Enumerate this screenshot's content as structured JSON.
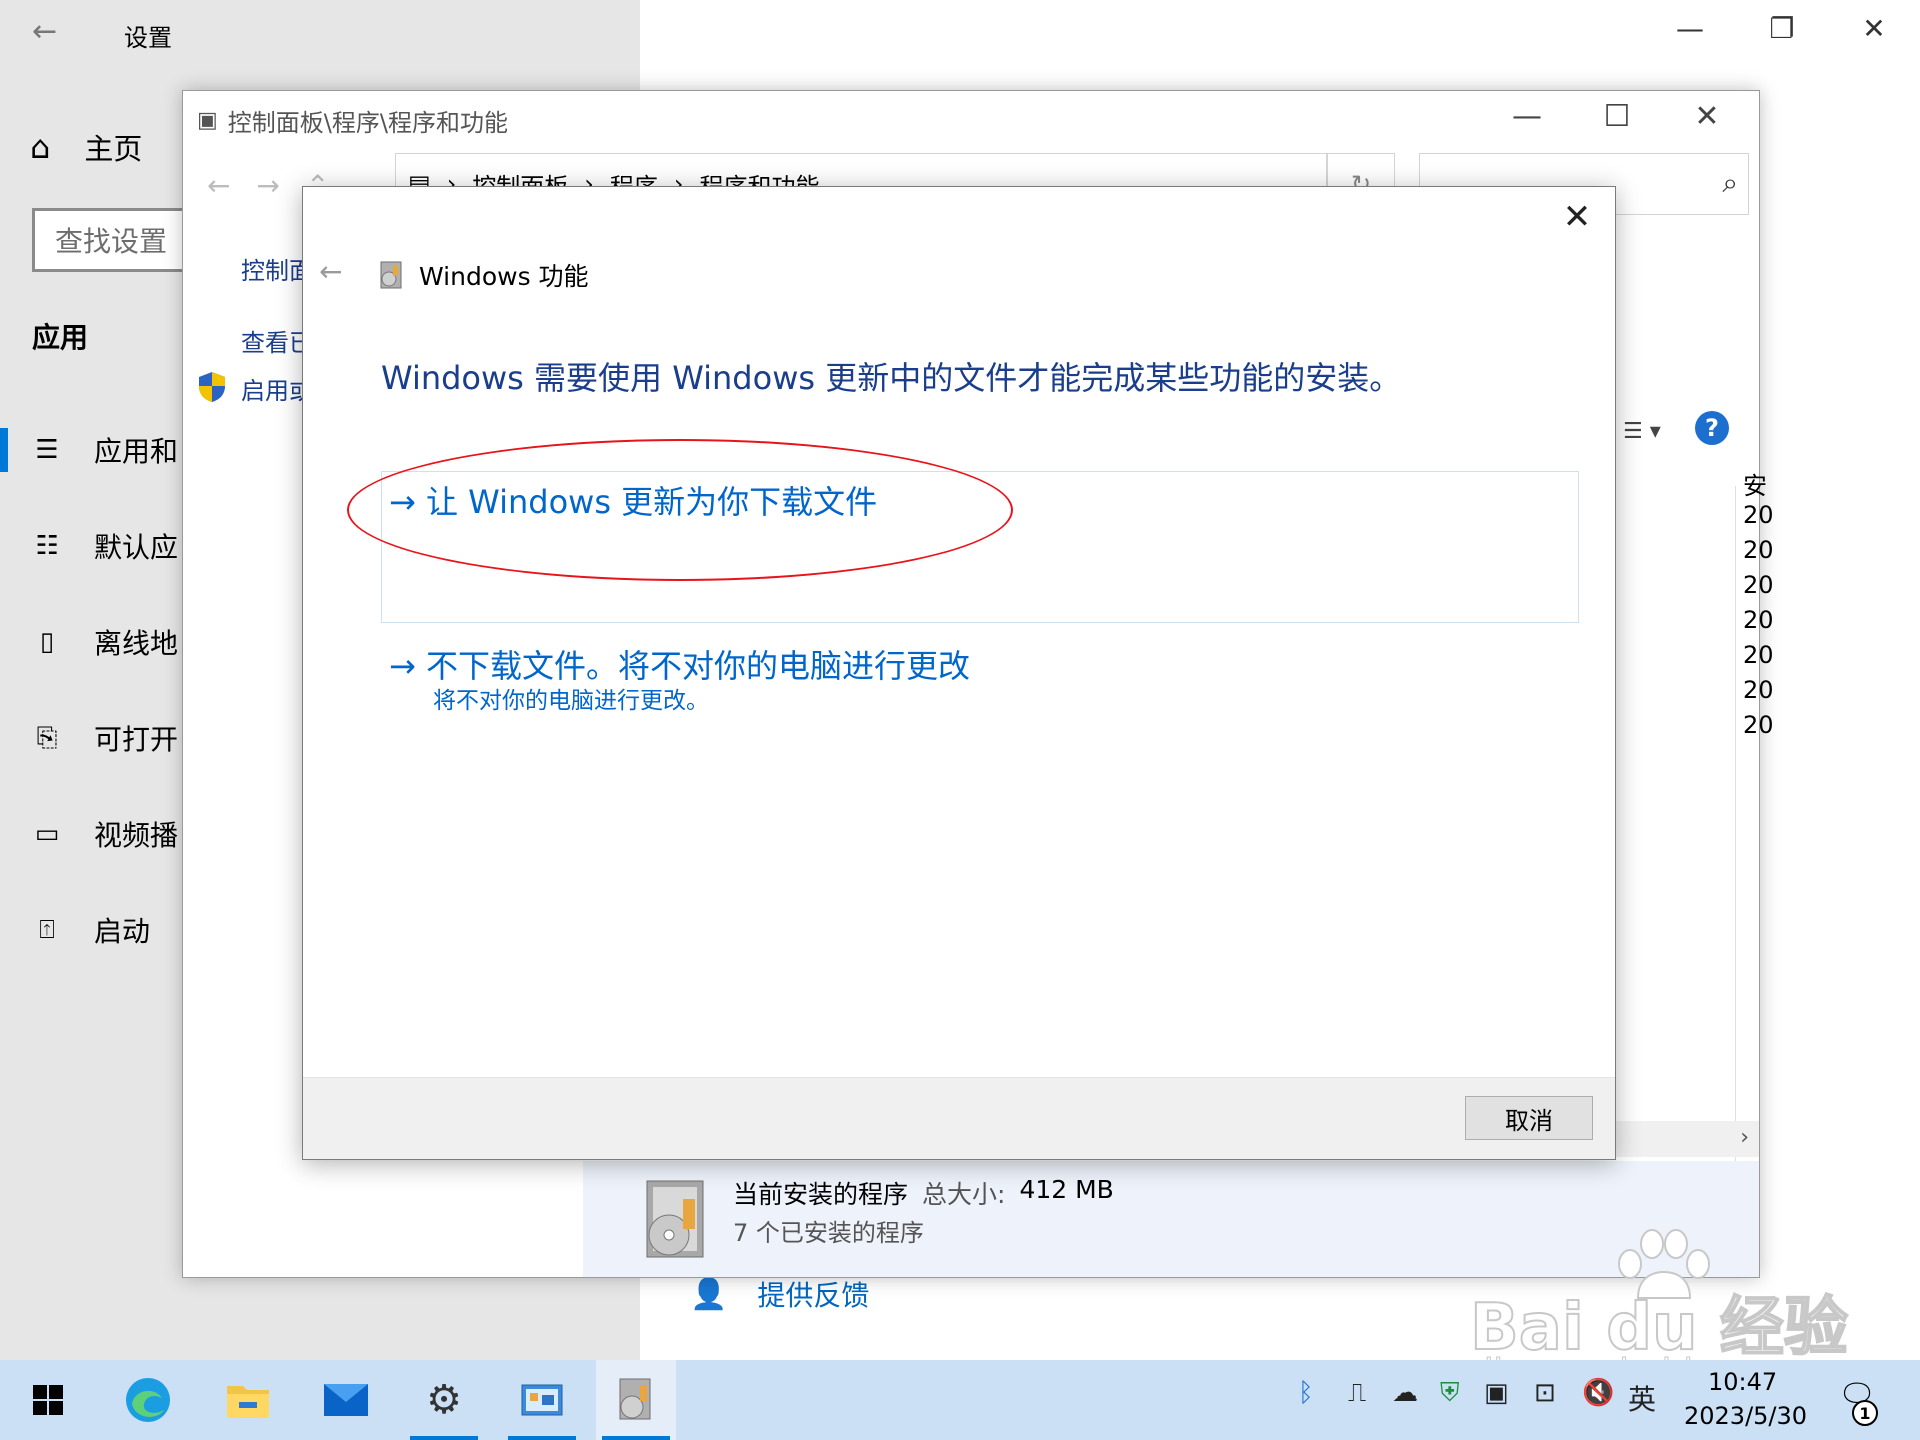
{
  "settings": {
    "title": "设置",
    "back_icon": "←",
    "minimize": "—",
    "restore": "❐",
    "close": "✕",
    "home_label": "主页",
    "search_placeholder": "查找设置",
    "section_title": "应用",
    "nav_items": [
      {
        "label": "应用和",
        "icon": "apps-features-icon"
      },
      {
        "label": "默认应",
        "icon": "default-apps-icon"
      },
      {
        "label": "离线地",
        "icon": "offline-maps-icon"
      },
      {
        "label": "可打开",
        "icon": "apps-for-websites-icon"
      },
      {
        "label": "视频播",
        "icon": "video-playback-icon"
      },
      {
        "label": "启动",
        "icon": "startup-icon"
      }
    ],
    "feedback_label": "提供反馈"
  },
  "control_panel": {
    "title": "控制面板\\程序\\程序和功能",
    "address": [
      "控制面板",
      "程序",
      "程序和功能"
    ],
    "left_links": [
      "控制面",
      "查看已",
      "启用或"
    ],
    "column_header": "安",
    "column_cells": [
      "20",
      "20",
      "20",
      "20",
      "20",
      "20",
      "20"
    ],
    "summary": {
      "label": "当前安装的程序",
      "size_label": "总大小:",
      "size_value": "412 MB",
      "count": "7 个已安装的程序"
    }
  },
  "dialog": {
    "title": "Windows 功能",
    "heading": "Windows 需要使用 Windows 更新中的文件才能完成某些功能的安装。",
    "option1": "→ 让 Windows 更新为你下载文件",
    "option2": "→ 不下载文件。将不对你的电脑进行更改",
    "option2_sub": "将不对你的电脑进行更改。",
    "cancel": "取消",
    "close": "✕"
  },
  "watermark": {
    "text": "Bai du 经验",
    "url": "jingyan.baidu.com"
  },
  "taskbar": {
    "apps": [
      "start-icon",
      "edge-icon",
      "file-explorer-icon",
      "mail-icon",
      "settings-icon",
      "control-panel-icon",
      "programs-features-icon"
    ],
    "ime": "英",
    "time": "10:47",
    "date": "2023/5/30",
    "notification_count": "1"
  },
  "colors": {
    "accent": "#0078d7",
    "link": "#0066cc",
    "heading": "#1a3e8c",
    "annotation": "#e8141b"
  }
}
